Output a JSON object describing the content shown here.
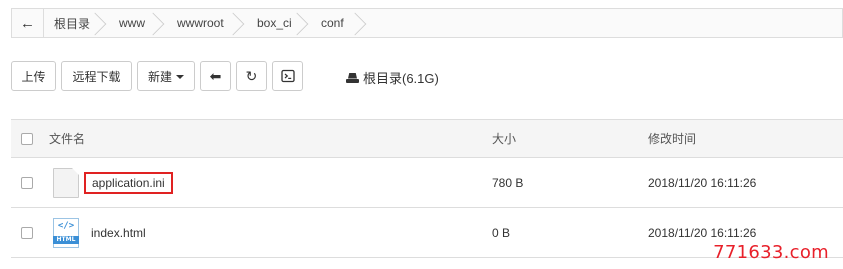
{
  "breadcrumb": {
    "back_icon": "←",
    "items": [
      "根目录",
      "www",
      "wwwroot",
      "box_ci",
      "conf"
    ]
  },
  "toolbar": {
    "upload_label": "上传",
    "remote_download_label": "远程下载",
    "new_label": "新建",
    "back_icon": "⬅",
    "refresh_icon": "↻",
    "terminal_icon": "⌨",
    "disk_label": "根目录(6.1G)"
  },
  "table": {
    "headers": {
      "name": "文件名",
      "size": "大小",
      "modified": "修改时间"
    },
    "rows": [
      {
        "name": "application.ini",
        "size": "780 B",
        "modified": "2018/11/20 16:11:26",
        "icon": "blank-file-icon"
      },
      {
        "name": "index.html",
        "size": "0 B",
        "modified": "2018/11/20 16:11:26",
        "icon": "html-file-icon"
      }
    ],
    "html_icon_code": "</>",
    "html_icon_tag": "HTML"
  },
  "watermark": "771633.com",
  "colors": {
    "highlight_border": "#e02222",
    "watermark": "#e8202a",
    "html_icon": "#3b8fd6"
  }
}
